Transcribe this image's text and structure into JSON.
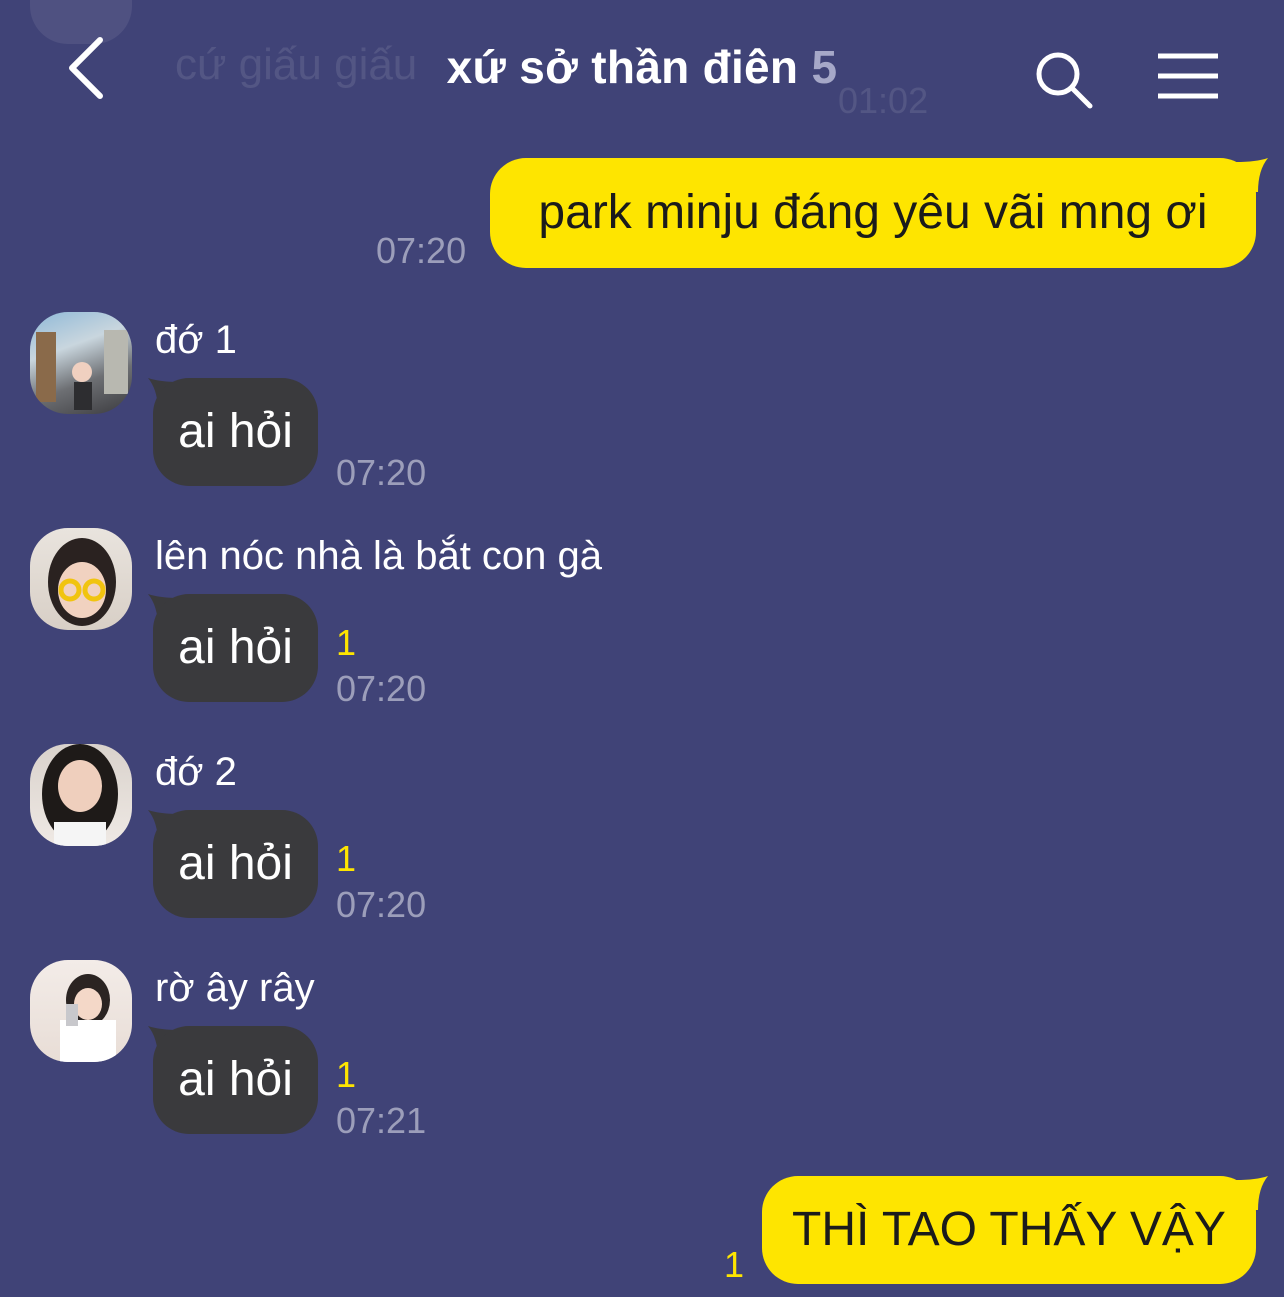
{
  "header": {
    "title": "xứ sở thần điên",
    "member_count": "5",
    "ghost_text": "cứ giấu giấu",
    "ghost_time": "01:02"
  },
  "colors": {
    "background": "#404377",
    "my_bubble": "#fee500",
    "other_bubble": "#3a3a3d",
    "unread": "#fee500",
    "timestamp": "#9c9eba"
  },
  "messages": [
    {
      "kind": "mine",
      "text": "park minju đáng yêu vãi mng ơi",
      "time": "07:20",
      "unread": ""
    },
    {
      "kind": "other",
      "sender": "đớ 1",
      "avatar_icon": "avatar-street-photo",
      "text": "ai hỏi",
      "time": "07:20",
      "unread": ""
    },
    {
      "kind": "other",
      "sender": "lên nóc nhà là bắt con gà",
      "avatar_icon": "avatar-girl-glasses",
      "text": "ai hỏi",
      "time": "07:20",
      "unread": "1"
    },
    {
      "kind": "other",
      "sender": "đớ 2",
      "avatar_icon": "avatar-girl-dark-hair",
      "text": "ai hỏi",
      "time": "07:20",
      "unread": "1"
    },
    {
      "kind": "other",
      "sender": "rờ ây rây",
      "avatar_icon": "avatar-girl-selfie",
      "text": "ai hỏi",
      "time": "07:21",
      "unread": "1"
    },
    {
      "kind": "mine",
      "text": "THÌ TAO THẤY VẬY",
      "time": "",
      "unread": "1"
    }
  ]
}
